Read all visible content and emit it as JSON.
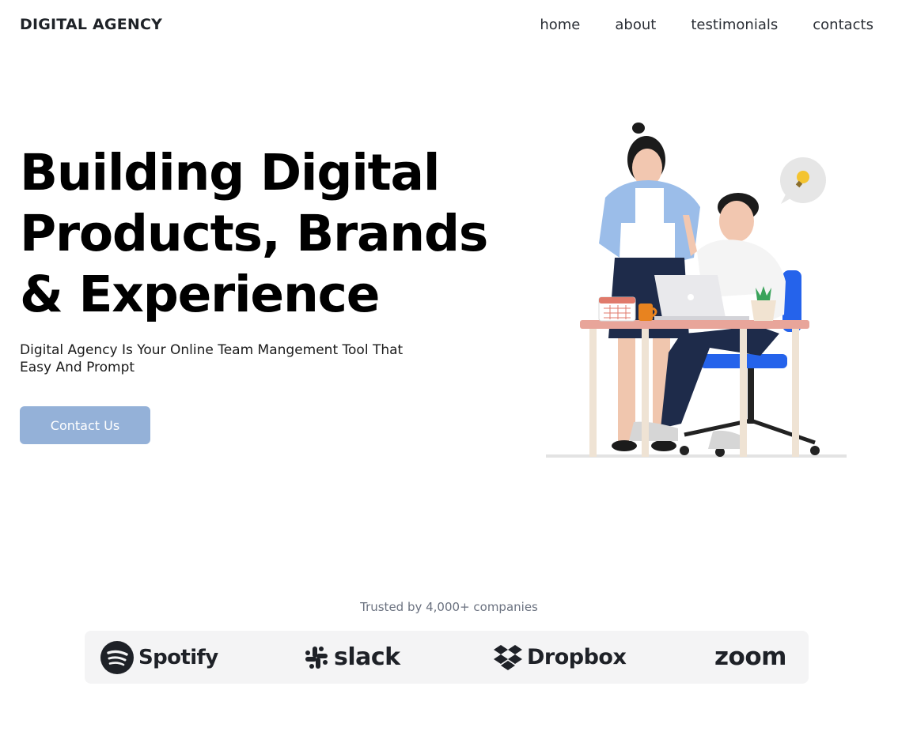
{
  "header": {
    "brand": "DIGITAL AGENCY",
    "nav": [
      "home",
      "about",
      "testimonials",
      "contacts"
    ]
  },
  "hero": {
    "title_lines": [
      "Building Digital",
      "Products, Brands",
      "& Experience"
    ],
    "subtitle": "Digital Agency Is Your Online Team Mangement Tool That Easy And Prompt",
    "cta_label": "Contact Us",
    "illustration_icon": "team-working-at-desk-illustration"
  },
  "trusted": {
    "text": "Trusted by 4,000+ companies",
    "logos": [
      {
        "name": "Spotify",
        "icon": "spotify-icon"
      },
      {
        "name": "slack",
        "icon": "slack-icon"
      },
      {
        "name": "Dropbox",
        "icon": "dropbox-icon"
      },
      {
        "name": "zoom",
        "icon": "zoom-wordmark"
      }
    ]
  },
  "colors": {
    "cta_background": "#94b1d8",
    "logos_strip": "#f4f4f5",
    "text_dark": "#1f2328",
    "muted_text": "#6b7280"
  }
}
